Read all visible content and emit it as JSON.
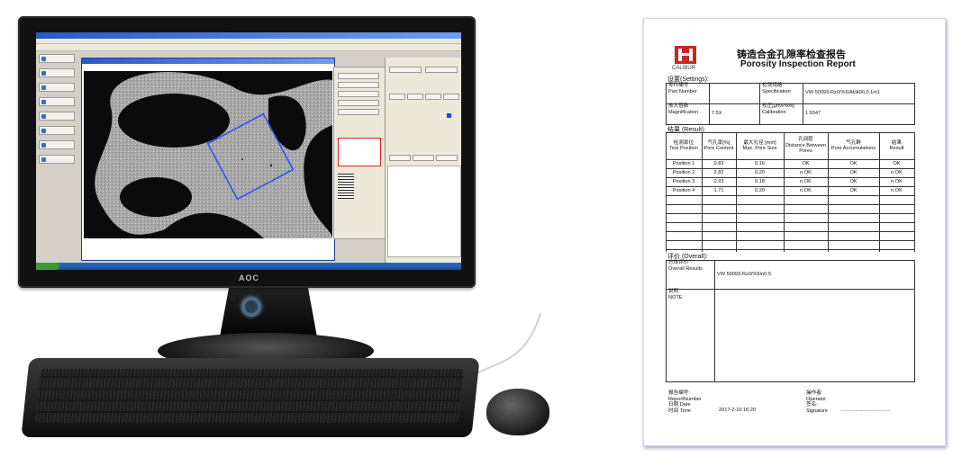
{
  "monitor": {
    "brand": "AOC"
  },
  "software": {
    "side_buttons": [
      "",
      "",
      "",
      "",
      "",
      "",
      "",
      ""
    ]
  },
  "report": {
    "logo_text": "CALIBUR",
    "title_cn": "铸造合金孔隙率检查报告",
    "title_en": "Porosity Inspection Report",
    "settings_heading": "设置(Settings):",
    "settings": {
      "part_number_label_cn": "零件编号",
      "part_number_label_en": "Part Number",
      "part_number_value": "",
      "specification_label_cn": "检测规格",
      "specification_label_en": "Specification",
      "specification_value": "VW 50093-Rz0/%5/At/A0/L0.1m1",
      "magnification_label_cn": "放大倍数",
      "magnification_label_en": "Magnification",
      "magnification_value": "7.5X",
      "calibration_label_cn": "校正[μm/Pixel]",
      "calibration_label_en": "Calibration",
      "calibration_value": "1.9347"
    },
    "result_heading": "结果 (Result):",
    "result_columns": [
      {
        "cn": "检测部位",
        "en": "Test Position"
      },
      {
        "cn": "气孔率[%]",
        "en": "Pore Content"
      },
      {
        "cn": "最大孔径 [mm]",
        "en": "Max. Pore Size"
      },
      {
        "cn": "孔间距",
        "en": "Distance Between Pores"
      },
      {
        "cn": "气孔群",
        "en": "Pore Accumulations"
      },
      {
        "cn": "结果",
        "en": "Result"
      }
    ],
    "result_rows": [
      [
        "Position 1",
        "0.83",
        "0.16",
        "OK",
        "OK",
        "OK"
      ],
      [
        "Position 2",
        "2.82",
        "0.20",
        "n.OK",
        "OK",
        "n.OK"
      ],
      [
        "Position 3",
        "0.93",
        "0.18",
        "n.OK",
        "OK",
        "n.OK"
      ],
      [
        "Position 4",
        "1.71",
        "0.20",
        "n.OK",
        "OK",
        "n.OK"
      ]
    ],
    "overall_heading": "评价 (Overall):",
    "overall": {
      "overall_label_cn": "总体评价",
      "overall_label_en": "Overall Results",
      "overall_value": "VW 50093-Rz0/%5/n0.5",
      "note_label_cn": "说明",
      "note_label_en": "NOTE"
    },
    "footer": {
      "report_number_cn": "报告编号:",
      "report_number_en": "ReportNumber",
      "date_cn": "日期 Date",
      "time_cn": "时间 Time",
      "datetime_value": "2017-2-10  16:20",
      "operator_cn": "操作者:",
      "operator_en": "Operator",
      "signature_cn": "签名:",
      "signature_en": "Signature",
      "signature_line": "..................................."
    }
  }
}
